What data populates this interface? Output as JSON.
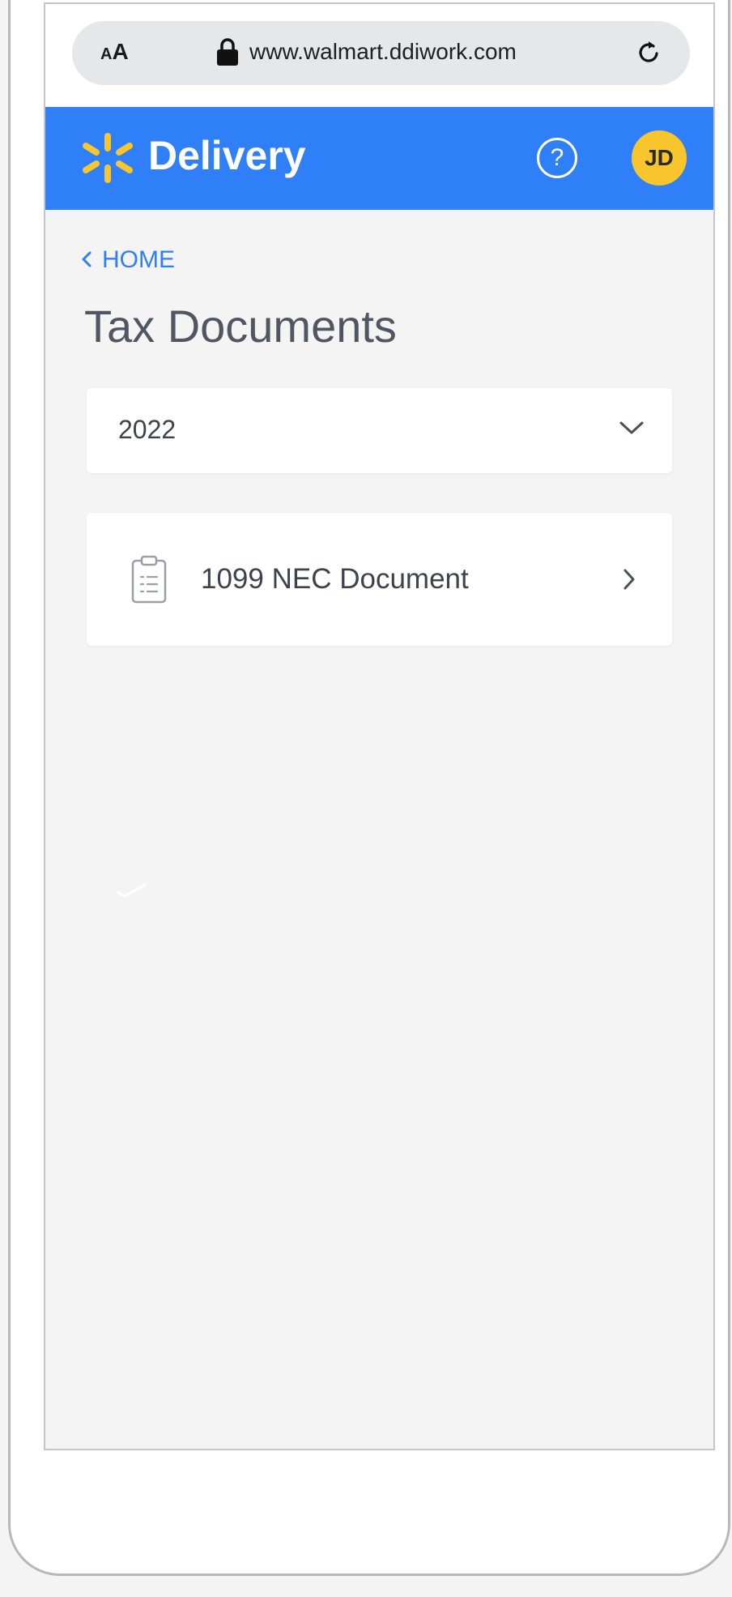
{
  "browser": {
    "text_size_label_small": "A",
    "text_size_label_large": "A",
    "url": "www.walmart.ddiwork.com"
  },
  "appbar": {
    "brand": "Delivery",
    "help_glyph": "?",
    "avatar_initials": "JD"
  },
  "navigation": {
    "back_label": "HOME"
  },
  "page": {
    "title": "Tax Documents"
  },
  "year_select": {
    "selected": "2022"
  },
  "documents": [
    {
      "label": "1099 NEC Document"
    }
  ],
  "icons": {
    "lock": "lock-icon",
    "reload": "reload-icon",
    "logo": "spark-logo",
    "help": "help-icon",
    "back": "chevron-left-icon",
    "dropdown": "chevron-down-icon",
    "document": "clipboard-icon",
    "row_arrow": "chevron-right-icon"
  },
  "colors": {
    "brand_blue": "#2f7ff8",
    "spark_yellow": "#f8c52d",
    "background": "#f4f4f5",
    "text": "#3d434c"
  }
}
